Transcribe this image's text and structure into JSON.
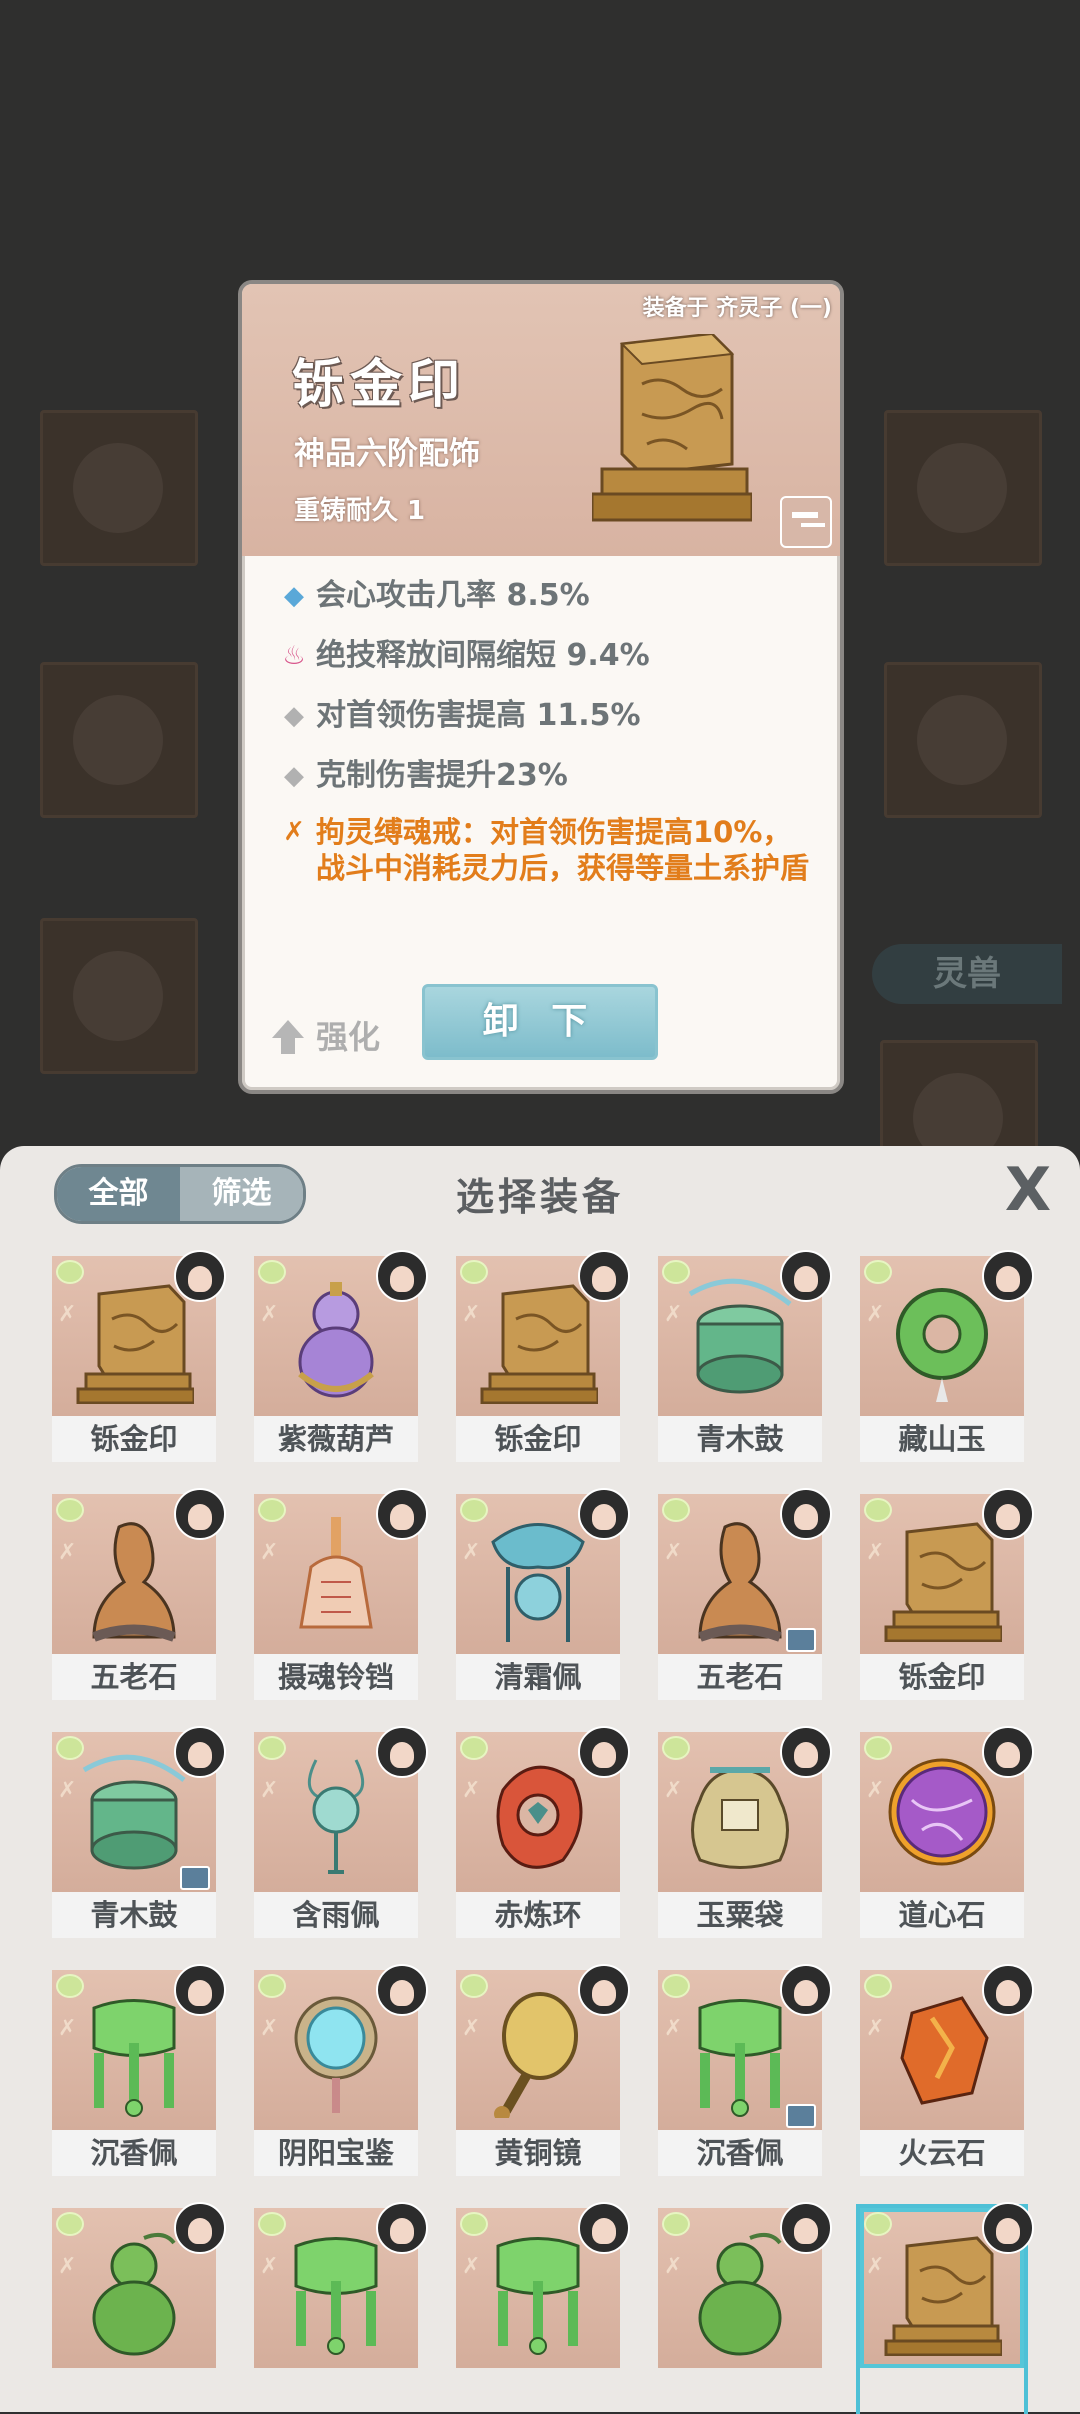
{
  "detail": {
    "equipped_on": "装备于 齐灵子 (一)",
    "name": "铄金印",
    "grade": "神品六阶配饰",
    "durability": "重铸耐久 1",
    "attributes": [
      {
        "text": "会心攻击几率 8.5%",
        "style": "blue"
      },
      {
        "text": "绝技释放间隔缩短 9.4%",
        "style": "pink"
      },
      {
        "text": "对首领伤害提高 11.5%",
        "style": "gray"
      },
      {
        "text": "克制伤害提升23%",
        "style": "gray"
      },
      {
        "text": "拘灵缚魂戒：对首领伤害提高10%，战斗中消耗灵力后，获得等量土系护盾",
        "style": "special"
      }
    ],
    "unequip_label": "卸 下",
    "enhance_label": "强化"
  },
  "background": {
    "beast_tag": "灵兽"
  },
  "panel": {
    "filter_all": "全部",
    "filter_screen": "筛选",
    "title": "选择装备",
    "close_glyph": "X"
  },
  "items": [
    {
      "name": "铄金印",
      "art": "seal"
    },
    {
      "name": "紫薇葫芦",
      "art": "gourd-purple"
    },
    {
      "name": "铄金印",
      "art": "seal"
    },
    {
      "name": "青木鼓",
      "art": "drum"
    },
    {
      "name": "藏山玉",
      "art": "jade-ring"
    },
    {
      "name": "五老石",
      "art": "stone"
    },
    {
      "name": "摄魂铃铛",
      "art": "bell"
    },
    {
      "name": "清霜佩",
      "art": "pendant-blue"
    },
    {
      "name": "五老石",
      "art": "stone"
    },
    {
      "name": "铄金印",
      "art": "seal"
    },
    {
      "name": "青木鼓",
      "art": "drum"
    },
    {
      "name": "含雨佩",
      "art": "pendant-teal"
    },
    {
      "name": "赤炼环",
      "art": "ring-red"
    },
    {
      "name": "玉粟袋",
      "art": "bag"
    },
    {
      "name": "道心石",
      "art": "orb-purple"
    },
    {
      "name": "沉香佩",
      "art": "pendant-green"
    },
    {
      "name": "阴阳宝鉴",
      "art": "mirror-blue"
    },
    {
      "name": "黄铜镜",
      "art": "mirror-brass"
    },
    {
      "name": "沉香佩",
      "art": "pendant-green"
    },
    {
      "name": "火云石",
      "art": "fire-stone"
    },
    {
      "name": "",
      "art": "gourd-green"
    },
    {
      "name": "",
      "art": "pendant-green"
    },
    {
      "name": "",
      "art": "pendant-green"
    },
    {
      "name": "",
      "art": "gourd-green"
    },
    {
      "name": "",
      "art": "seal"
    }
  ],
  "colors": {
    "accent": "#4ec0d6",
    "special_text": "#e27d1b",
    "panel_bg": "#ebe8e5",
    "tile_bg": "#dbb6a4"
  }
}
